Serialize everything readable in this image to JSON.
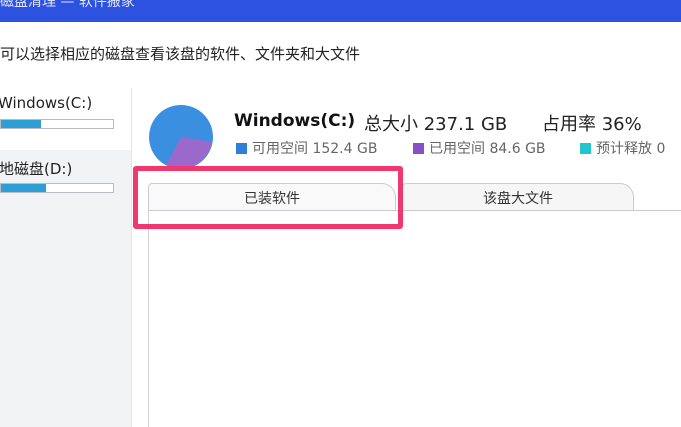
{
  "window": {
    "title": "磁盘清理 — 软件搬家"
  },
  "subtitle": "可以选择相应的磁盘查看该盘的软件、文件夹和大文件",
  "sidebar": {
    "drives": [
      {
        "name": "Windows(C:)",
        "usage_percent": 36
      },
      {
        "name": "本地磁盘(D:)",
        "usage_percent": 40
      }
    ]
  },
  "disk_info": {
    "name": "Windows(C:)",
    "total_label": "总大小 237.1 GB",
    "usage_label": "占用率 36%",
    "legend": [
      {
        "text": "可用空间 152.4 GB",
        "color": "#2f7fd8"
      },
      {
        "text": "已用空间 84.6 GB",
        "color": "#8a4fc4"
      },
      {
        "text": "预计释放 0",
        "color": "#1fc6cf"
      }
    ],
    "pie_colors": {
      "free": "#3b8fe0",
      "used": "#8a4fc4"
    }
  },
  "tabs": [
    {
      "label": "已装软件"
    },
    {
      "label": "该盘大文件"
    }
  ],
  "highlight": {
    "color": "#f0386e"
  }
}
